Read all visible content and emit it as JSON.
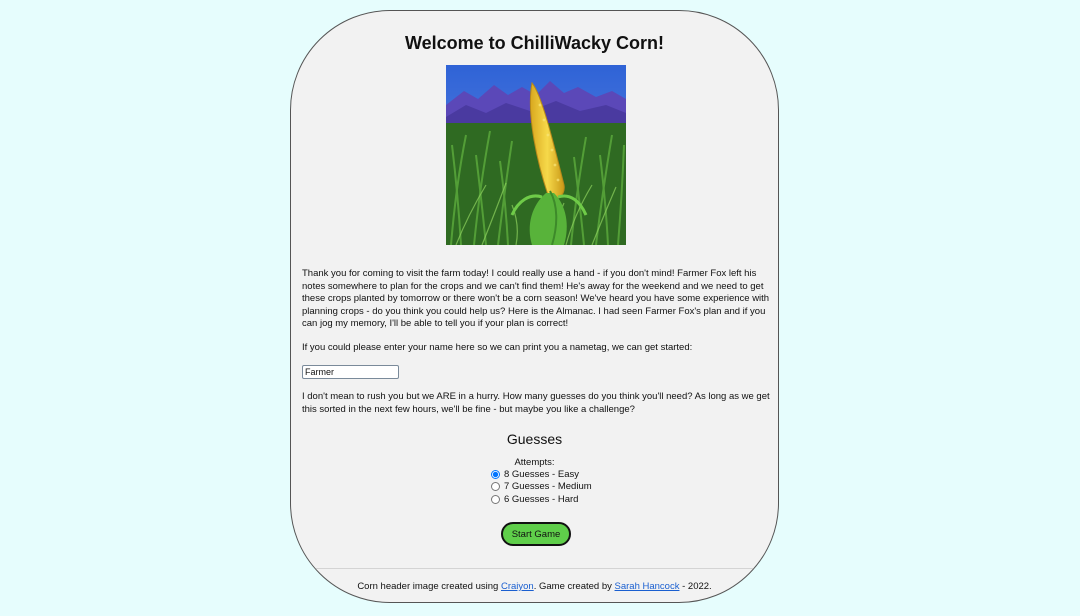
{
  "page": {
    "title": "Welcome to ChilliWacky Corn!",
    "hero_image": {
      "icon": "corn-field-mountains-illustration",
      "colors": {
        "sky": "#3d6fd8",
        "mountains": "#5b48b8",
        "field": "#2f6a22",
        "corn": "#e9c93a"
      }
    }
  },
  "intro": {
    "text": "Thank you for coming to visit the farm today! I could really use a hand - if you don't mind! Farmer Fox left his notes somewhere to plan for the crops and we can't find them! He's away for the weekend and we need to get these crops planted by tomorrow or there won't be a corn season! We've heard you have some experience with planning crops - do you think you could help us? Here is the Almanac. I had seen Farmer Fox's plan and if you can jog my memory, I'll be able to tell you if your plan is correct!"
  },
  "name_form": {
    "prompt": "If you could please enter your name here so we can print you a nametag, we can get started:",
    "value": "Farmer"
  },
  "rush": {
    "text": "I don't mean to rush you but we ARE in a hurry. How many guesses do you think you'll need? As long as we get this sorted in the next few hours, we'll be fine - but maybe you like a challenge?"
  },
  "guesses": {
    "heading": "Guesses",
    "attempts_label": "Attempts:",
    "options": [
      {
        "label": "8 Guesses - Easy",
        "checked": true
      },
      {
        "label": "7 Guesses - Medium",
        "checked": false
      },
      {
        "label": "6 Guesses - Hard",
        "checked": false
      }
    ]
  },
  "start_button": {
    "label": "Start Game",
    "color": "#5fce4a"
  },
  "footer": {
    "prefix": "Corn header image created using ",
    "link1": "Craiyon",
    "middle": ". Game created by ",
    "link2": "Sarah Hancock",
    "suffix": " - 2022."
  },
  "colors": {
    "background": "#e6fdfd",
    "card": "#f2f2f2",
    "link": "#1a5fd0"
  }
}
